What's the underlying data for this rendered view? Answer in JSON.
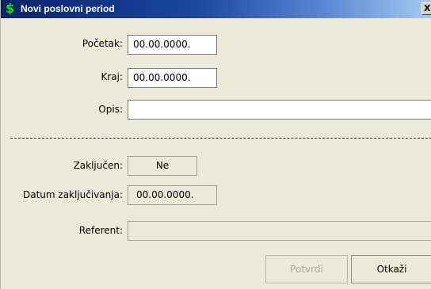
{
  "window": {
    "title": "Novi poslovni period",
    "close_glyph": "X",
    "icon": "dollar-icon",
    "title_gradient": [
      "#0a246a",
      "#a6caf0"
    ]
  },
  "form": {
    "pocetak": {
      "label": "Početak:",
      "value": "00.00.0000."
    },
    "kraj": {
      "label": "Kraj:",
      "value": "00.00.0000."
    },
    "opis": {
      "label": "Opis:",
      "value": ""
    },
    "zakljucen": {
      "label": "Zaključen:",
      "value": "Ne"
    },
    "datum_zakljucivanja": {
      "label": "Datum zaključivanja:",
      "value": "00.00.0000."
    },
    "referent": {
      "label": "Referent:",
      "value": ""
    }
  },
  "buttons": {
    "confirm": "Potvrdi",
    "cancel": "Otkaži"
  }
}
